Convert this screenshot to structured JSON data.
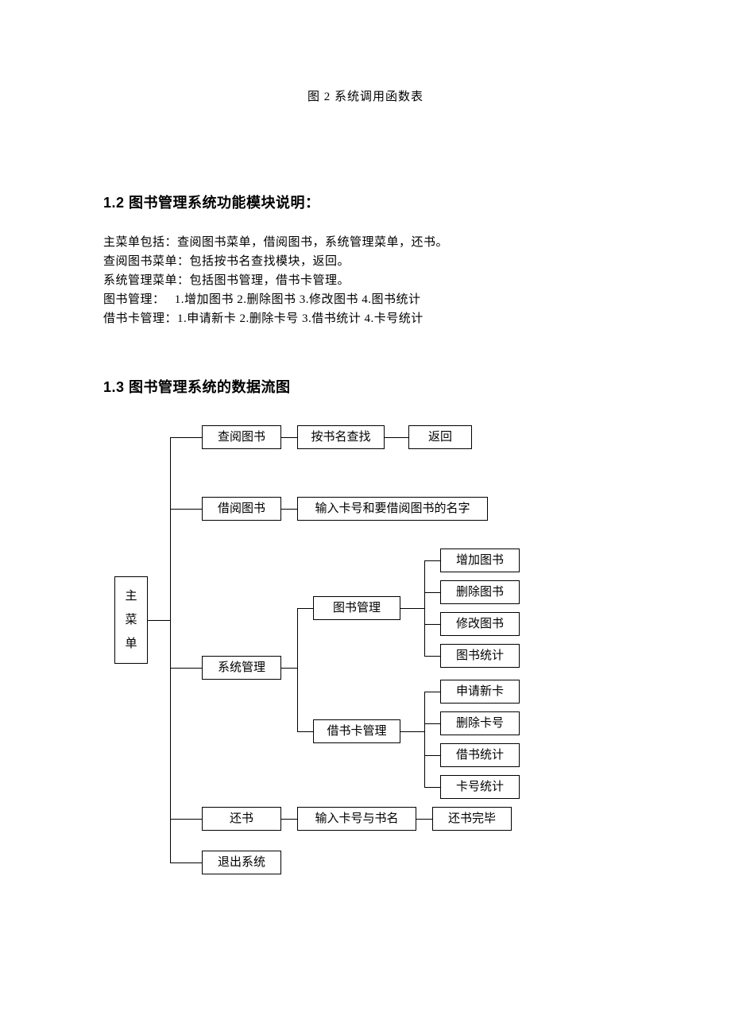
{
  "caption": "图 2 系统调用函数表",
  "heading1": "1.2 图书管理系统功能模块说明：",
  "p1": "主菜单包括：查阅图书菜单，借阅图书，系统管理菜单，还书。",
  "p2": "查阅图书菜单：包括按书名查找模块，返回。",
  "p3": "系统管理菜单：包括图书管理，借书卡管理。",
  "p4": "图书管理：　 1.增加图书 2.删除图书 3.修改图书 4.图书统计",
  "p5": "借书卡管理：1.申请新卡 2.删除卡号 3.借书统计 4.卡号统计",
  "heading2": "1.3 图书管理系统的数据流图",
  "diagram": {
    "root": "主菜单",
    "n_browse": "查阅图书",
    "n_bytitle": "按书名查找",
    "n_return": "返回",
    "n_borrow": "借阅图书",
    "n_borrow_input": "输入卡号和要借阅图书的名字",
    "n_sys": "系统管理",
    "n_bookmgr": "图书管理",
    "n_add": "增加图书",
    "n_del": "删除图书",
    "n_mod": "修改图书",
    "n_stat": "图书统计",
    "n_cardmgr": "借书卡管理",
    "n_newcard": "申请新卡",
    "n_delcard": "删除卡号",
    "n_borrstat": "借书统计",
    "n_cardstat": "卡号统计",
    "n_back": "还书",
    "n_back_input": "输入卡号与书名",
    "n_back_done": "还书完毕",
    "n_exit": "退出系统"
  }
}
